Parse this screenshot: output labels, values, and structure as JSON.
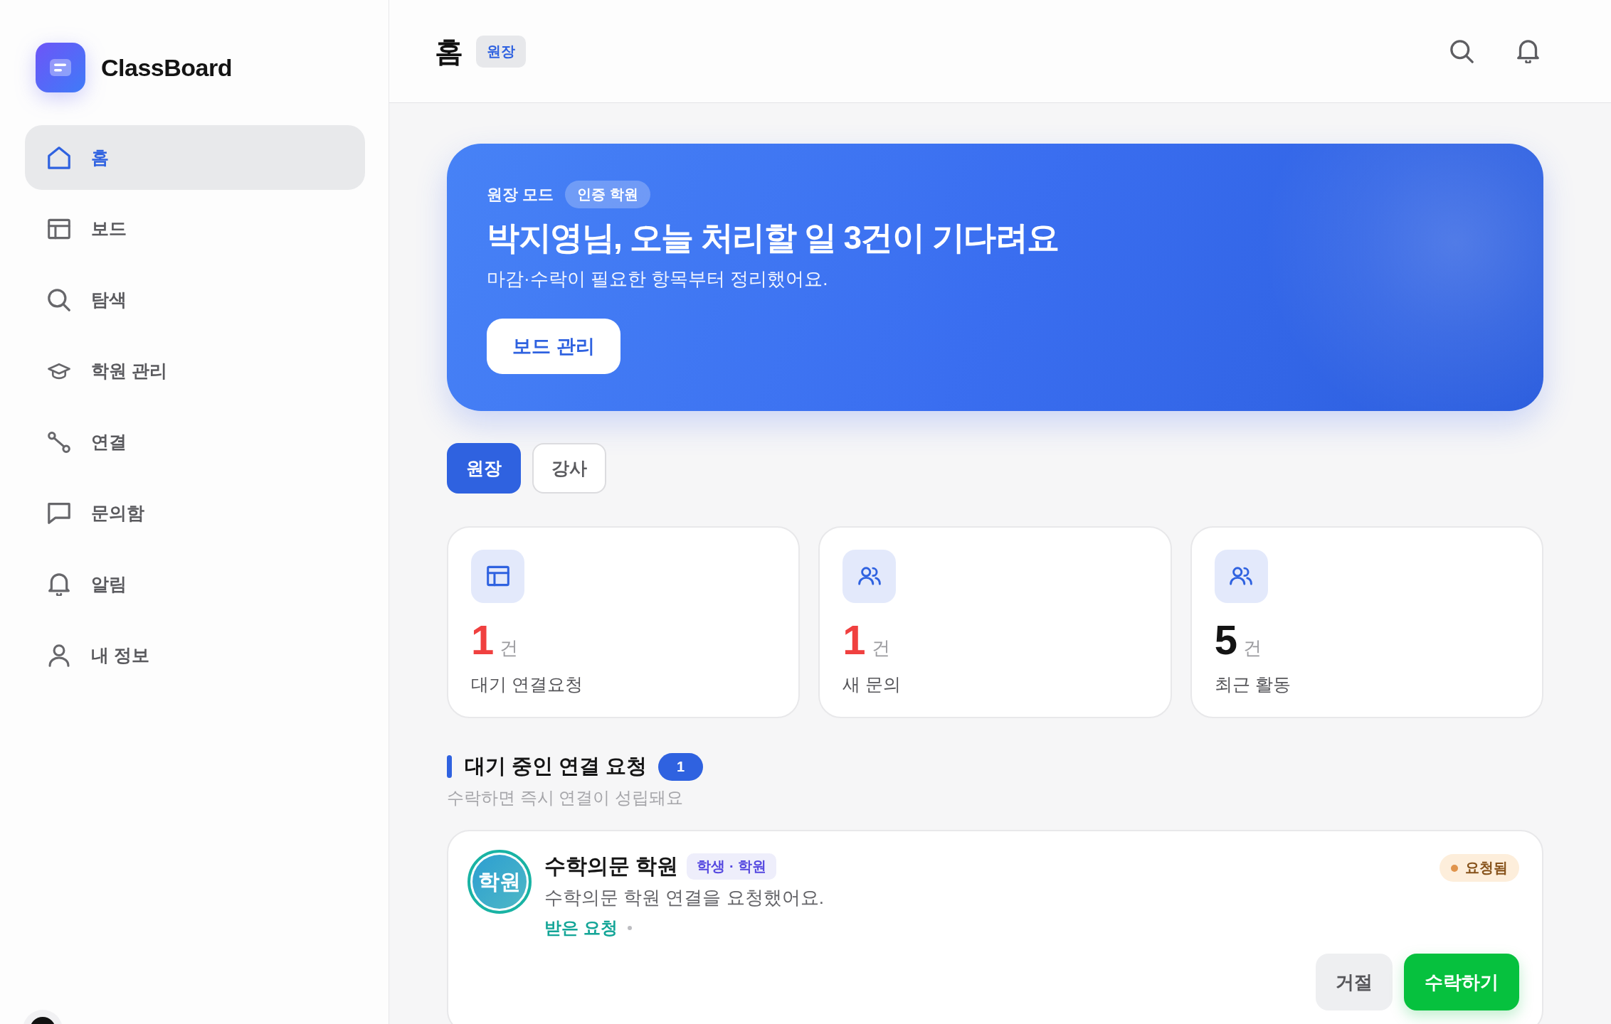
{
  "sidebar": {
    "brand": "ClassBoard",
    "items": [
      {
        "label": "홈",
        "selected": true
      },
      {
        "label": "보드",
        "selected": false
      },
      {
        "label": "탐색",
        "selected": false
      },
      {
        "label": "학원 관리",
        "selected": false
      },
      {
        "label": "연결",
        "selected": false
      },
      {
        "label": "문의함",
        "selected": false
      },
      {
        "label": "알림",
        "selected": false
      },
      {
        "label": "내 정보",
        "selected": false
      }
    ]
  },
  "header": {
    "title": "홈",
    "role_badge": "원장"
  },
  "banner": {
    "eyebrow": "원장 모드",
    "badge": "인증 학원",
    "headline": "박지영님, 오늘 처리할 일 3건이 기다려요",
    "subtitle": "마감·수락이 필요한 항목부터 정리했어요.",
    "button": "보드 관리"
  },
  "role_tabs": [
    {
      "label": "원장",
      "selected": true
    },
    {
      "label": "강사",
      "selected": false
    }
  ],
  "stats": [
    {
      "value": "1",
      "unit": "건",
      "label": "대기 연결요청",
      "urgent": true
    },
    {
      "value": "1",
      "unit": "건",
      "label": "새 문의",
      "urgent": true
    },
    {
      "value": "5",
      "unit": "건",
      "label": "최근 활동",
      "urgent": false
    }
  ],
  "pending_section": {
    "title": "대기 중인 연결 요청",
    "count": "1",
    "subtitle": "수락하면 즉시 연결이 성립돼요"
  },
  "requests": [
    {
      "avatar_text": "학원",
      "name": "수학의문 학원",
      "tag": "학생 · 학원",
      "message": "수학의문 학원 연결을 요청했어요.",
      "direction": "받은 요청",
      "status": "요청됨",
      "reject_button": "거절",
      "accept_button": "수락하기"
    }
  ]
}
